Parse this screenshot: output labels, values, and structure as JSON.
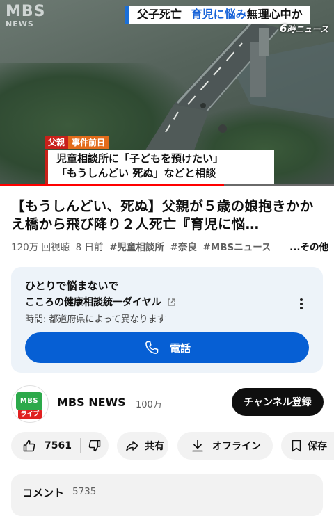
{
  "video": {
    "watermark_main": "MBS",
    "watermark_sub": "NEWS",
    "headline_top_a": "父子死亡",
    "headline_top_b": "育児に悩み",
    "headline_top_c": "無理心中か",
    "program_num": "6",
    "program_label": "時ニュース",
    "caption_tag_1": "父親",
    "caption_tag_2": "事件前日",
    "caption_line_1": "児童相談所に「子どもを預けたい」",
    "caption_line_2": "「もうしんどい 死ぬ」などと相談",
    "progress": 0.67
  },
  "title": "【もうしんどい、死ぬ】父親が５歳の娘抱きかかえ橋から飛び降り２人死亡『育児に悩…",
  "meta": {
    "views": "120万 回視聴",
    "age": "8 日前",
    "tags": [
      "#児童相談所",
      "#奈良",
      "#MBSニュース"
    ],
    "more": "...その他"
  },
  "helpline": {
    "line1": "ひとりで悩まないで",
    "line2": "こころの健康相談統一ダイヤル",
    "line3": "時間: 都道府県によって異なります",
    "call_label": "電話",
    "icons": [
      "external-link-icon",
      "more-vert-icon",
      "phone-icon"
    ]
  },
  "channel": {
    "avatar_text": "MBS",
    "avatar_badge": "ライブ",
    "name": "MBS NEWS",
    "subscribers": "100万",
    "subscribe_label": "チャンネル登録"
  },
  "actions": {
    "like_count": "7561",
    "share_label": "共有",
    "offline_label": "オフライン",
    "save_label": "保存"
  },
  "comments": {
    "label": "コメント",
    "count": "5735"
  },
  "colors": {
    "accent_blue": "#065fd4",
    "progress_red": "#ff0000",
    "caption_red": "#c9211a"
  }
}
